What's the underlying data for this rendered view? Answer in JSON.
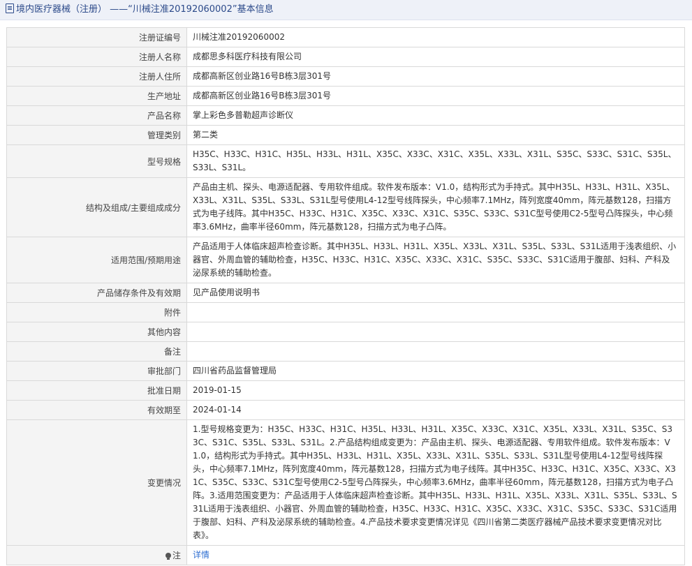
{
  "header": {
    "title": "境内医疗器械（注册）  ——“川械注准20192060002”基本信息"
  },
  "rows": [
    {
      "label": "注册证编号",
      "value": "川械注准20192060002"
    },
    {
      "label": "注册人名称",
      "value": "成都思多科医疗科技有限公司"
    },
    {
      "label": "注册人住所",
      "value": "成都高新区创业路16号B栋3层301号"
    },
    {
      "label": "生产地址",
      "value": "成都高新区创业路16号B栋3层301号"
    },
    {
      "label": "产品名称",
      "value": "掌上彩色多普勒超声诊断仪"
    },
    {
      "label": "管理类别",
      "value": "第二类"
    },
    {
      "label": "型号规格",
      "value": "H35C、H33C、H31C、H35L、H33L、H31L、X35C、X33C、X31C、X35L、X33L、X31L、S35C、S33C、S31C、S35L、S33L、S31L。"
    },
    {
      "label": "结构及组成/主要组成成分",
      "value": "产品由主机、探头、电源适配器、专用软件组成。软件发布版本：V1.0，结构形式为手持式。其中H35L、H33L、H31L、X35L、X33L、X31L、S35L、S33L、S31L型号使用L4-12型号线阵探头，中心频率7.1MHz，阵列宽度40mm，阵元基数128，扫描方式为电子线阵。其中H35C、H33C、H31C、X35C、X33C、X31C、S35C、S33C、S31C型号使用C2-5型号凸阵探头，中心频率3.6MHz，曲率半径60mm，阵元基数128，扫描方式为电子凸阵。"
    },
    {
      "label": "适用范围/预期用途",
      "value": "产品适用于人体临床超声检查诊断。其中H35L、H33L、H31L、X35L、X33L、X31L、S35L、S33L、S31L适用于浅表组织、小器官、外周血管的辅助检查，H35C、H33C、H31C、X35C、X33C、X31C、S35C、S33C、S31C适用于腹部、妇科、产科及泌尿系统的辅助检查。"
    },
    {
      "label": "产品储存条件及有效期",
      "value": "见产品使用说明书"
    },
    {
      "label": "附件",
      "value": ""
    },
    {
      "label": "其他内容",
      "value": ""
    },
    {
      "label": "备注",
      "value": ""
    },
    {
      "label": "审批部门",
      "value": "四川省药品监督管理局"
    },
    {
      "label": "批准日期",
      "value": "2019-01-15"
    },
    {
      "label": "有效期至",
      "value": "2024-01-14"
    },
    {
      "label": "变更情况",
      "value": "1.型号规格变更为：H35C、H33C、H31C、H35L、H33L、H31L、X35C、X33C、X31C、X35L、X33L、X31L、S35C、S33C、S31C、S35L、S33L、S31L。2.产品结构组成变更为：产品由主机、探头、电源适配器、专用软件组成。软件发布版本：V1.0，结构形式为手持式。其中H35L、H33L、H31L、X35L、X33L、X31L、S35L、S33L、S31L型号使用L4-12型号线阵探头，中心频率7.1MHz，阵列宽度40mm，阵元基数128，扫描方式为电子线阵。其中H35C、H33C、H31C、X35C、X33C、X31C、S35C、S33C、S31C型号使用C2-5型号凸阵探头，中心频率3.6MHz，曲率半径60mm，阵元基数128，扫描方式为电子凸阵。3.适用范围变更为：产品适用于人体临床超声检查诊断。其中H35L、H33L、H31L、X35L、X33L、X31L、S35L、S33L、S31L适用于浅表组织、小器官、外周血管的辅助检查，H35C、H33C、H31C、X35C、X33C、X31C、S35C、S33C、S31C适用于腹部、妇科、产科及泌尿系统的辅助检查。4.产品技术要求变更情况详见《四川省第二类医疗器械产品技术要求变更情况对比表》。"
    }
  ],
  "note": {
    "label": "注",
    "link_text": "详情",
    "icon": "lightbulb-icon"
  }
}
